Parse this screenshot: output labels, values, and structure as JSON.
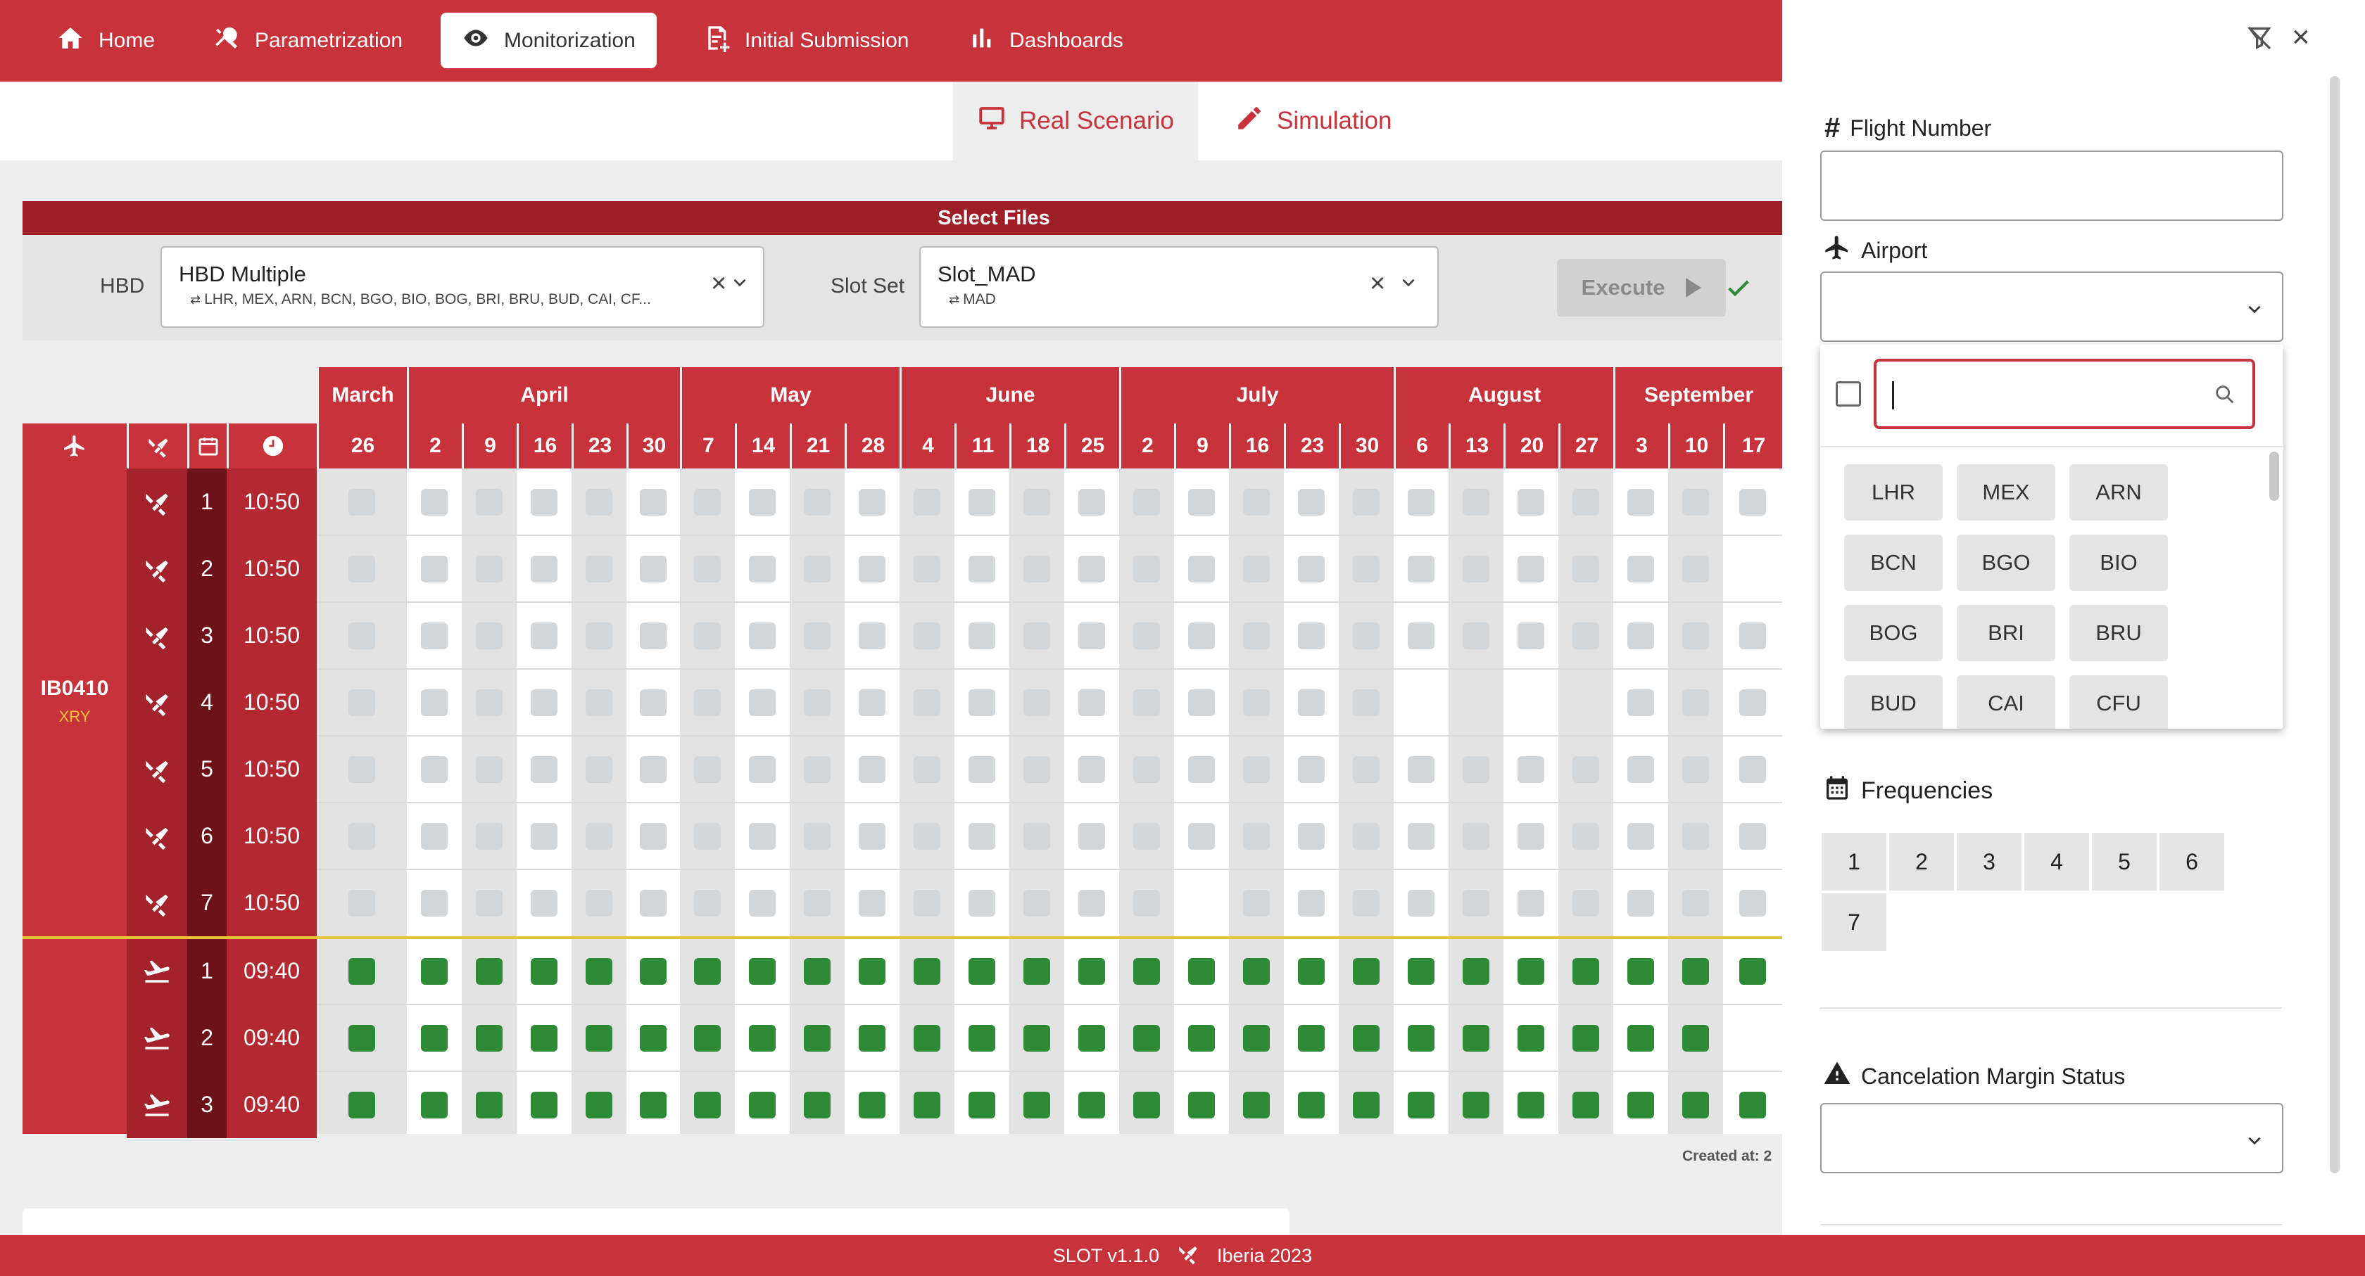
{
  "nav": {
    "items": [
      {
        "label": "Home",
        "icon": "home-icon"
      },
      {
        "label": "Parametrization",
        "icon": "tools-icon"
      },
      {
        "label": "Monitorization",
        "icon": "eye-icon"
      },
      {
        "label": "Initial Submission",
        "icon": "document-add-icon"
      },
      {
        "label": "Dashboards",
        "icon": "bar-chart-icon"
      }
    ],
    "active": "Monitorization"
  },
  "subtabs": {
    "real": "Real Scenario",
    "simulation": "Simulation",
    "active": "Real Scenario"
  },
  "files": {
    "title": "Select Files",
    "hbd_label": "HBD",
    "hbd_value": "HBD Multiple",
    "hbd_sub": "LHR, MEX, ARN, BCN, BGO, BIO, BOG, BRI, BRU, BUD, CAI, CF...",
    "slot_label": "Slot Set",
    "slot_value": "Slot_MAD",
    "slot_sub": "MAD",
    "execute_label": "Execute"
  },
  "grid": {
    "months": [
      "March",
      "April",
      "May",
      "June",
      "July",
      "August",
      "September"
    ],
    "days": [
      "26",
      "2",
      "9",
      "16",
      "23",
      "30",
      "7",
      "14",
      "21",
      "28",
      "4",
      "11",
      "18",
      "25",
      "2",
      "9",
      "16",
      "23",
      "30",
      "6",
      "13",
      "20",
      "27",
      "3",
      "10",
      "17"
    ],
    "flight_number": "IB0410",
    "flight_type": "XRY",
    "rows": [
      {
        "dir": "arrival",
        "freq": "1",
        "time": "10:50"
      },
      {
        "dir": "arrival",
        "freq": "2",
        "time": "10:50"
      },
      {
        "dir": "arrival",
        "freq": "3",
        "time": "10:50"
      },
      {
        "dir": "arrival",
        "freq": "4",
        "time": "10:50"
      },
      {
        "dir": "arrival",
        "freq": "5",
        "time": "10:50"
      },
      {
        "dir": "arrival",
        "freq": "6",
        "time": "10:50"
      },
      {
        "dir": "arrival",
        "freq": "7",
        "time": "10:50"
      },
      {
        "dir": "departure",
        "freq": "1",
        "time": "09:40"
      },
      {
        "dir": "departure",
        "freq": "2",
        "time": "09:40"
      },
      {
        "dir": "departure",
        "freq": "3",
        "time": "09:40"
      }
    ],
    "created_at": "Created at:  2"
  },
  "footer": {
    "app": "SLOT  v1.1.0",
    "company": "Iberia 2023"
  },
  "panel": {
    "flight_number_label": "Flight Number",
    "flight_number_value": "",
    "airport_label": "Airport",
    "airport_value": "",
    "search_value": "",
    "airports": [
      "LHR",
      "MEX",
      "ARN",
      "BCN",
      "BGO",
      "BIO",
      "BOG",
      "BRI",
      "BRU",
      "BUD",
      "CAI",
      "CFU"
    ],
    "frequencies_label": "Frequencies",
    "frequencies": [
      "1",
      "2",
      "3",
      "4",
      "5",
      "6",
      "7"
    ],
    "cancel_label": "Cancelation Margin Status",
    "cancel_value": ""
  },
  "colors": {
    "brand": "#c8323a",
    "brand_dark": "#9e1f27",
    "slot_ok": "#2e8b35",
    "slot_empty": "#d3d6d9",
    "separator": "#e8c33c"
  }
}
